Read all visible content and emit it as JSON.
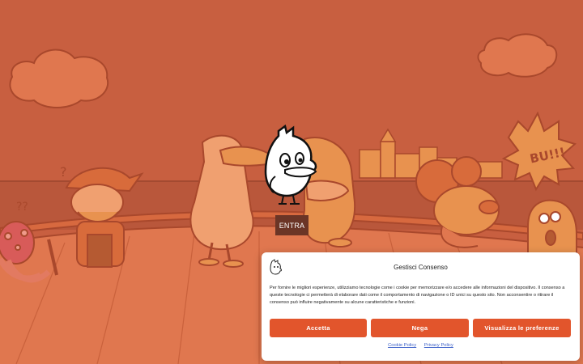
{
  "scene": {
    "sign_text": "BU!!!",
    "colors": {
      "sky": "#c85f40",
      "sea": "#b9573b",
      "deck": "#e0774f",
      "enter_button": "#6b3526"
    }
  },
  "enter_label": "ENTRA",
  "consent": {
    "title": "Gestisci Consenso",
    "text": "Per fornire le migliori esperienze, utilizziamo tecnologie come i cookie per memorizzare e/o accedere alle informazioni del dispositivo. Il consenso a queste tecnologie ci permetterà di elaborare dati come il comportamento di navigazione o ID unici su questo sito. Non acconsentire o ritirare il consenso può influire negativamente su alcune caratteristiche e funzioni.",
    "accept_label": "Accetta",
    "deny_label": "Nega",
    "preferences_label": "Visualizza le preferenze",
    "cookie_policy_label": "Cookie Policy",
    "privacy_policy_label": "Privacy Policy",
    "accent_color": "#e2552c"
  }
}
